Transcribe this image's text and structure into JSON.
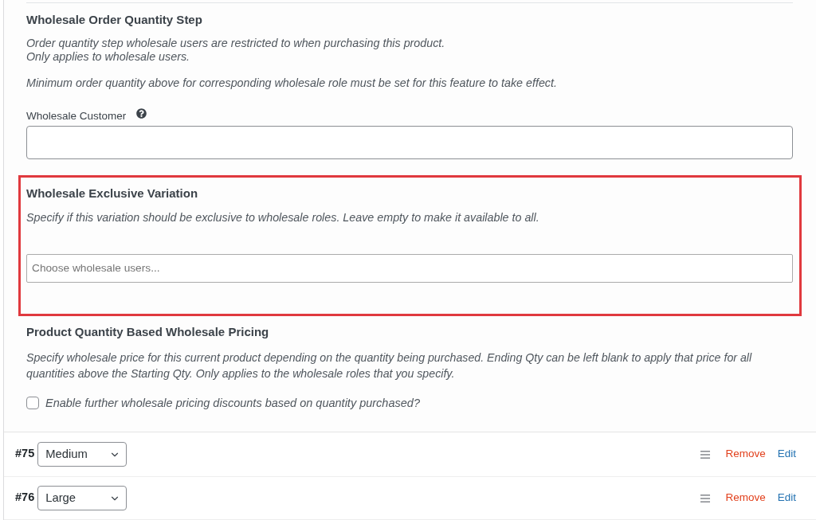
{
  "quantity_step": {
    "title": "Wholesale Order Quantity Step",
    "description": [
      "Order quantity step wholesale users are restricted to when purchasing this product.",
      "Only applies to wholesale users."
    ],
    "note": "Minimum order quantity above for corresponding wholesale role must be set for this feature to take effect.",
    "field": {
      "label": "Wholesale Customer"
    }
  },
  "exclusive_variation": {
    "highlighted": true,
    "title": "Wholesale Exclusive Variation",
    "description": "Specify if this variation should be exclusive to wholesale roles. Leave empty to make it available to all.",
    "field": {
      "placeholder": "Choose wholesale users..."
    }
  },
  "quantity_pricing": {
    "title": "Product Quantity Based Wholesale Pricing",
    "description": "Specify wholesale price for this current product depending on the quantity being purchased. Ending Qty can be left blank to apply that price for all quantities above the Starting Qty. Only applies to the wholesale roles that you specify.",
    "checkbox": {
      "label": "Enable further wholesale pricing discounts based on quantity purchased?",
      "checked": false
    }
  },
  "variations": [
    {
      "number": "#75",
      "attribute": "Medium",
      "remove_label": "Remove",
      "edit_label": "Edit"
    },
    {
      "number": "#76",
      "attribute": "Large",
      "remove_label": "Remove",
      "edit_label": "Edit"
    }
  ]
}
